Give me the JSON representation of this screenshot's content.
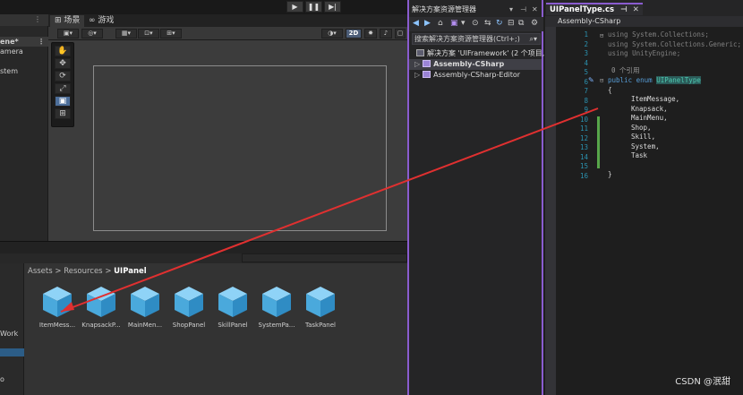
{
  "unity": {
    "playbar": {
      "play_icon": "▶",
      "pause_icon": "❚❚",
      "step_icon": "▶|"
    },
    "hierarchy": {
      "items": [
        {
          "label": "ene*",
          "selected": true
        },
        {
          "label": "amera",
          "selected": false
        },
        {
          "label": "stem",
          "selected": false
        }
      ]
    },
    "tabs": {
      "scene": "场景",
      "game": "游戏"
    },
    "scene_toolbar": {
      "mode_2d": "2D"
    },
    "tools": [
      "✋",
      "✥",
      "⟳",
      "⤢",
      "▣",
      "⊞"
    ],
    "project": {
      "left_items": [
        "Work",
        "o"
      ],
      "breadcrumb": {
        "root": "Assets",
        "sep1": ">",
        "mid": "Resources",
        "sep2": ">",
        "current": "UIPanel"
      },
      "assets": [
        {
          "name": "ItemMess..."
        },
        {
          "name": "KnapsackP..."
        },
        {
          "name": "MainMen..."
        },
        {
          "name": "ShopPanel"
        },
        {
          "name": "SkillPanel"
        },
        {
          "name": "SystemPa..."
        },
        {
          "name": "TaskPanel"
        }
      ]
    }
  },
  "solution_explorer": {
    "title": "解决方案资源管理器",
    "search_placeholder": "搜索解决方案资源管理器(Ctrl+;)",
    "solution_label": "解决方案 'UIFramework' (2 个项目,",
    "projects": [
      {
        "label": "Assembly-CSharp",
        "selected": true
      },
      {
        "label": "Assembly-CSharp-Editor",
        "selected": false
      }
    ]
  },
  "editor": {
    "tab_title": "UIPanelType.cs",
    "nav_project": "Assembly-CSharp",
    "line_numbers": [
      "1",
      "2",
      "3",
      "4",
      "5",
      "6",
      "7",
      "8",
      "9",
      "10",
      "11",
      "12",
      "13",
      "14",
      "15",
      "16"
    ],
    "codelens": "0 个引用",
    "usings": [
      "System.Collections;",
      "System.Collections.Generic;",
      "UnityEngine;"
    ],
    "enum_keyword": "public enum",
    "enum_name": "UIPanelType",
    "open_brace": "{",
    "members": [
      "ItemMessage,",
      "Knapsack,",
      "MainMenu,",
      "Shop,",
      "Skill,",
      "System,",
      "Task"
    ],
    "close_brace": "}"
  },
  "watermark": "CSDN @泯甜",
  "colors": {
    "accent": "#8a5ccf",
    "arrow": "#e03030",
    "cube": "#5bb6e8"
  }
}
